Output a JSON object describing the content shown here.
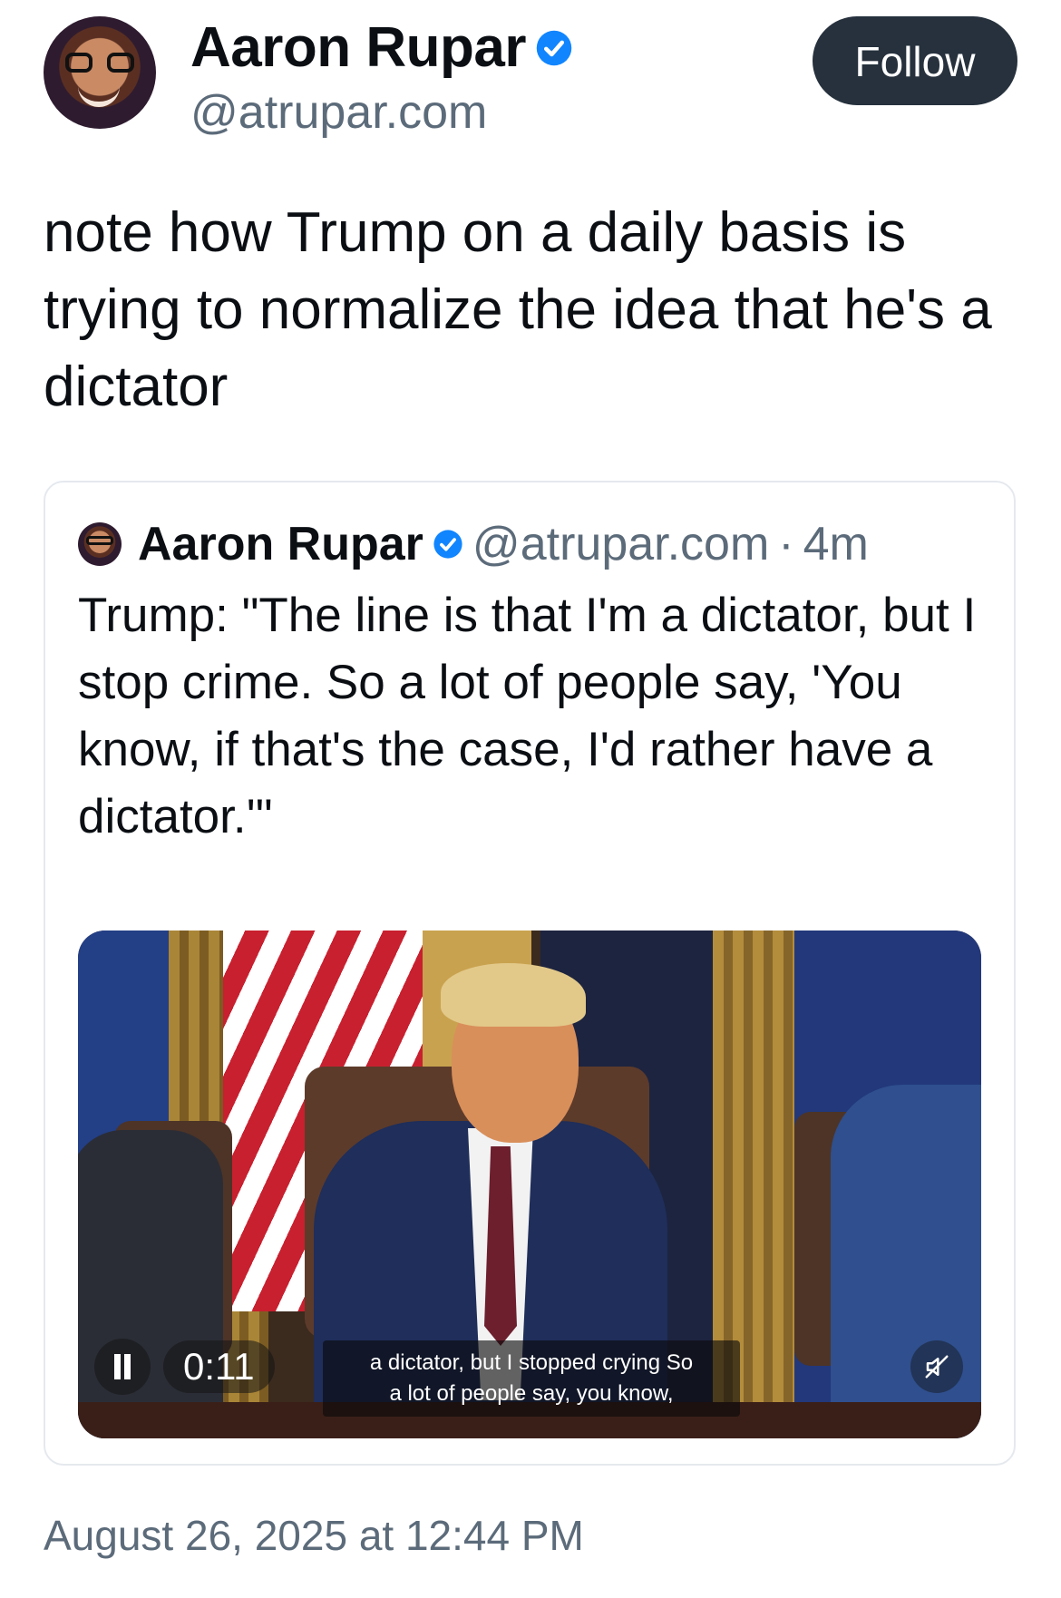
{
  "post": {
    "author": {
      "display_name": "Aaron Rupar",
      "handle": "@atrupar.com",
      "verified": true
    },
    "follow_label": "Follow",
    "text": "note how Trump on a daily basis is trying to normalize the idea that he's a dictator",
    "timestamp": "August 26, 2025 at 12:44 PM"
  },
  "quote": {
    "author": {
      "display_name": "Aaron Rupar",
      "handle": "@atrupar.com",
      "separator": "·",
      "time_ago": "4m"
    },
    "text": "Trump: \"The line is that I'm a dictator, but I stop crime. So a lot of people say, 'You know, if that's the case, I'd rather have a dictator.'\"",
    "video": {
      "timecode": "0:11",
      "caption_line_1": "a dictator, but I stopped crying So",
      "caption_line_2": "a lot of people say, you know,",
      "state": "playing",
      "muted": true
    }
  },
  "colors": {
    "verified_blue": "#1185fe",
    "follow_bg": "#26313d",
    "muted_text": "#5c6b7a",
    "card_border": "#e5e9ee"
  },
  "icons": {
    "verified": "verified-badge-icon",
    "pause": "pause-icon",
    "mute": "muted-speaker-icon"
  }
}
